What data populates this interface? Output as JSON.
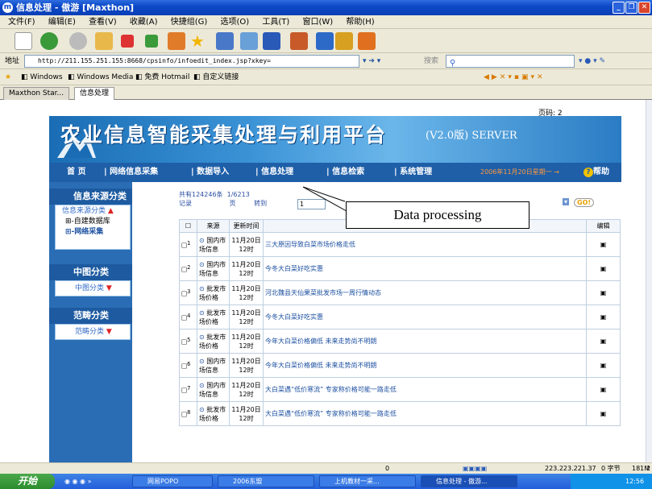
{
  "window": {
    "title": "信息处理 - 傲游 [Maxthon]"
  },
  "menu": [
    "文件(F)",
    "编辑(E)",
    "查看(V)",
    "收藏(A)",
    "快捷组(G)",
    "选项(O)",
    "工具(T)",
    "窗口(W)",
    "帮助(H)"
  ],
  "address": {
    "label": "地址",
    "url": "http://211.155.251.155:8668/cpsinfo/infoedit_index.jsp?xkey=",
    "search_label": "搜索"
  },
  "favorites": [
    "Windows",
    "Windows Media",
    "免费 Hotmail",
    "自定义链接"
  ],
  "tabs": [
    "Maxthon Star...",
    "信息处理"
  ],
  "page": {
    "page_no": "页码: 2",
    "banner_title": "农业信息智能采集处理与利用平台",
    "banner_version": "(V2.0版) SERVER",
    "nav": [
      "首 页",
      "网络信息采集",
      "数据导入",
      "信息处理",
      "信息检索",
      "系统管理"
    ],
    "date": "2006年11月20日星期一",
    "help": "帮助",
    "sections": [
      {
        "title": "信息来源分类",
        "dropdown": "信息来源分类",
        "tree": [
          "自建数据库",
          "网络采集"
        ]
      },
      {
        "title": "中图分类",
        "dropdown": "中图分类"
      },
      {
        "title": "范畴分类",
        "dropdown": "范畴分类"
      }
    ],
    "pager": {
      "total": "共有124246条",
      "pages": "1/6213",
      "unit_record": "记录",
      "unit_page": "页",
      "goto": "转到",
      "goto_value": "1",
      "go": "GO!"
    },
    "table": {
      "headers": [
        "来源",
        "更新时间",
        "",
        "编辑"
      ],
      "rows": [
        {
          "no": "1",
          "src": "国内市场信息",
          "time": "11月20日 12时",
          "title": "三大原因导致白菜市场价格走低"
        },
        {
          "no": "2",
          "src": "国内市场信息",
          "time": "11月20日 12时",
          "title": "今冬大白菜好吃实惠"
        },
        {
          "no": "3",
          "src": "批发市场价格",
          "time": "11月20日 12时",
          "title": "河北魏县天仙果菜批发市场一周行情动态"
        },
        {
          "no": "4",
          "src": "批发市场价格",
          "time": "11月20日 12时",
          "title": "今冬大白菜好吃实惠"
        },
        {
          "no": "5",
          "src": "批发市场价格",
          "time": "11月20日 12时",
          "title": "今年大白菜价格偏低 未来走势尚不明朗"
        },
        {
          "no": "6",
          "src": "国内市场信息",
          "time": "11月20日 12时",
          "title": "今年大白菜价格偏低 未来走势尚不明朗"
        },
        {
          "no": "7",
          "src": "国内市场信息",
          "time": "11月20日 12时",
          "title": "大白菜遇“低价寒流” 专家称价格可能一路走低"
        },
        {
          "no": "8",
          "src": "批发市场价格",
          "time": "11月20日 12时",
          "title": "大白菜遇“低价寒流” 专家称价格可能一路走低"
        }
      ]
    },
    "callout": "Data processing"
  },
  "status": {
    "zero": "0",
    "ip": "223.223.221.37",
    "bytes": "0 字节",
    "mem": "181M",
    "extra": "2"
  },
  "taskbar": {
    "start": "开始",
    "tasks": [
      "网易POPO",
      "2006东盟",
      "上机教材一采...",
      "信息处理 - 傲游..."
    ],
    "clock": "12:56"
  }
}
